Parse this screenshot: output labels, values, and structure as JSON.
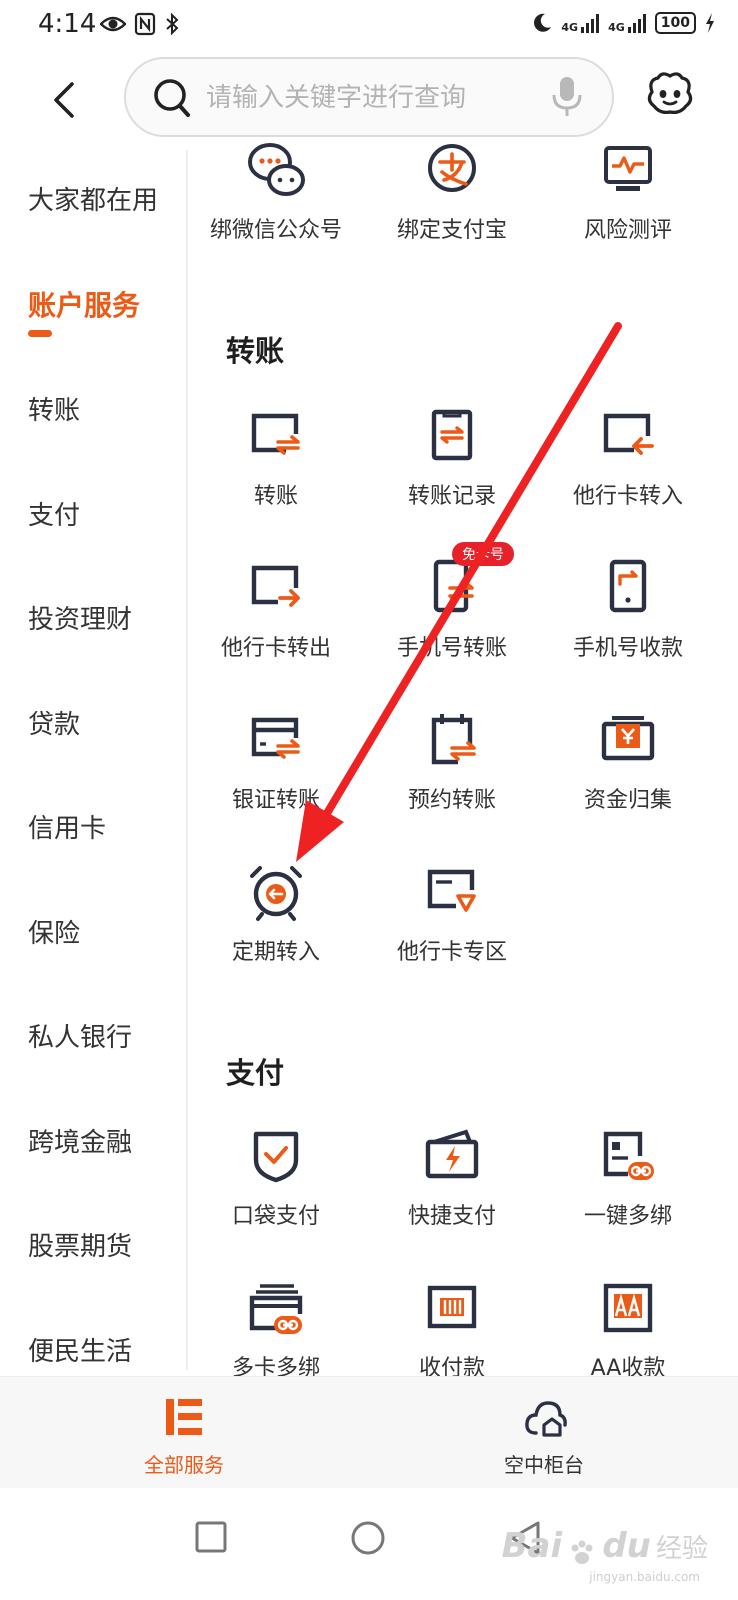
{
  "status": {
    "time": "4:14",
    "network1": "4G",
    "network2": "4G",
    "battery": "100"
  },
  "search": {
    "placeholder": "请输入关键字进行查询"
  },
  "sidebar": {
    "items": [
      {
        "label": "大家都在用"
      },
      {
        "label": "账户服务"
      },
      {
        "label": "转账"
      },
      {
        "label": "支付"
      },
      {
        "label": "投资理财"
      },
      {
        "label": "贷款"
      },
      {
        "label": "信用卡"
      },
      {
        "label": "保险"
      },
      {
        "label": "私人银行"
      },
      {
        "label": "跨境金融"
      },
      {
        "label": "股票期货"
      },
      {
        "label": "便民生活"
      }
    ],
    "active_index": 1
  },
  "account_row": [
    {
      "label": "绑微信公众号",
      "icon": "wechat-icon"
    },
    {
      "label": "绑定支付宝",
      "icon": "alipay-icon"
    },
    {
      "label": "风险测评",
      "icon": "risk-monitor-icon"
    }
  ],
  "transfer": {
    "title": "转账",
    "items": [
      {
        "label": "转账",
        "icon": "transfer-icon"
      },
      {
        "label": "转账记录",
        "icon": "transfer-record-icon"
      },
      {
        "label": "他行卡转入",
        "icon": "other-card-in-icon"
      },
      {
        "label": "他行卡转出",
        "icon": "other-card-out-icon"
      },
      {
        "label": "手机号转账",
        "icon": "phone-transfer-icon",
        "badge": "免卡号"
      },
      {
        "label": "手机号收款",
        "icon": "phone-receive-icon"
      },
      {
        "label": "银证转账",
        "icon": "bank-securities-icon"
      },
      {
        "label": "预约转账",
        "icon": "scheduled-transfer-icon"
      },
      {
        "label": "资金归集",
        "icon": "fund-collection-icon"
      },
      {
        "label": "定期转入",
        "icon": "alarm-clock-icon"
      },
      {
        "label": "他行卡专区",
        "icon": "other-card-zone-icon"
      }
    ]
  },
  "payment": {
    "title": "支付",
    "items": [
      {
        "label": "口袋支付",
        "icon": "pocket-pay-icon"
      },
      {
        "label": "快捷支付",
        "icon": "quick-pay-icon"
      },
      {
        "label": "一键多绑",
        "icon": "one-key-bind-icon"
      },
      {
        "label": "多卡多绑",
        "icon": "multi-card-bind-icon"
      },
      {
        "label": "收付款",
        "icon": "barcode-icon"
      },
      {
        "label": "AA收款",
        "icon": "aa-receive-icon"
      }
    ]
  },
  "tabbar": {
    "all_services": "全部服务",
    "air_counter": "空中柜台"
  },
  "watermark": {
    "brand": "Bai",
    "brand2": "du",
    "cn": "经验",
    "url": "jingyan.baidu.com"
  },
  "colors": {
    "accent": "#ec5a17",
    "icon_dark": "#2b3142",
    "badge_red": "#e6212a",
    "arrow_red": "#ee2222"
  }
}
